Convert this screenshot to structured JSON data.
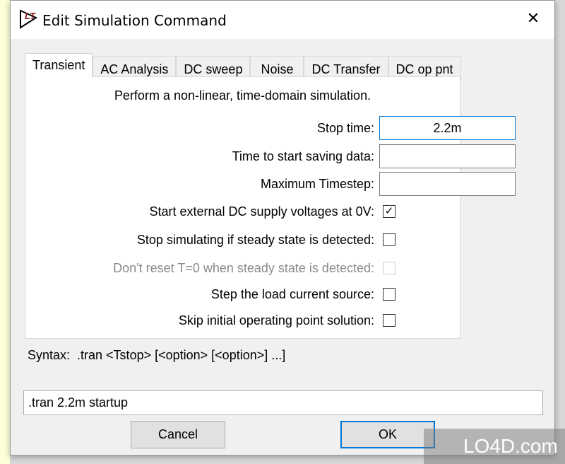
{
  "window": {
    "title": "Edit Simulation Command",
    "close": "✕"
  },
  "tabs": [
    {
      "label": "Transient",
      "active": true
    },
    {
      "label": "AC Analysis"
    },
    {
      "label": "DC sweep"
    },
    {
      "label": "Noise"
    },
    {
      "label": "DC Transfer"
    },
    {
      "label": "DC op pnt"
    }
  ],
  "transient": {
    "description": "Perform a non-linear, time-domain simulation.",
    "fields": [
      {
        "label": "Stop time:",
        "value": "2.2m"
      },
      {
        "label": "Time to start saving data:",
        "value": ""
      },
      {
        "label": "Maximum Timestep:",
        "value": ""
      }
    ],
    "options": [
      {
        "label": "Start external DC supply voltages at 0V:",
        "checked": true,
        "enabled": true
      },
      {
        "label": "Stop simulating if steady state is detected:",
        "checked": false,
        "enabled": true
      },
      {
        "label": "Don't reset T=0 when steady state is detected:",
        "checked": false,
        "enabled": false
      },
      {
        "label": "Step the load current source:",
        "checked": false,
        "enabled": true
      },
      {
        "label": "Skip initial operating point solution:",
        "checked": false,
        "enabled": true
      }
    ]
  },
  "syntax": "Syntax:  .tran <Tstop> [<option> [<option>] ...]",
  "command": ".tran 2.2m startup",
  "buttons": {
    "cancel": "Cancel",
    "ok": "OK"
  },
  "watermark": "LO4D.com"
}
